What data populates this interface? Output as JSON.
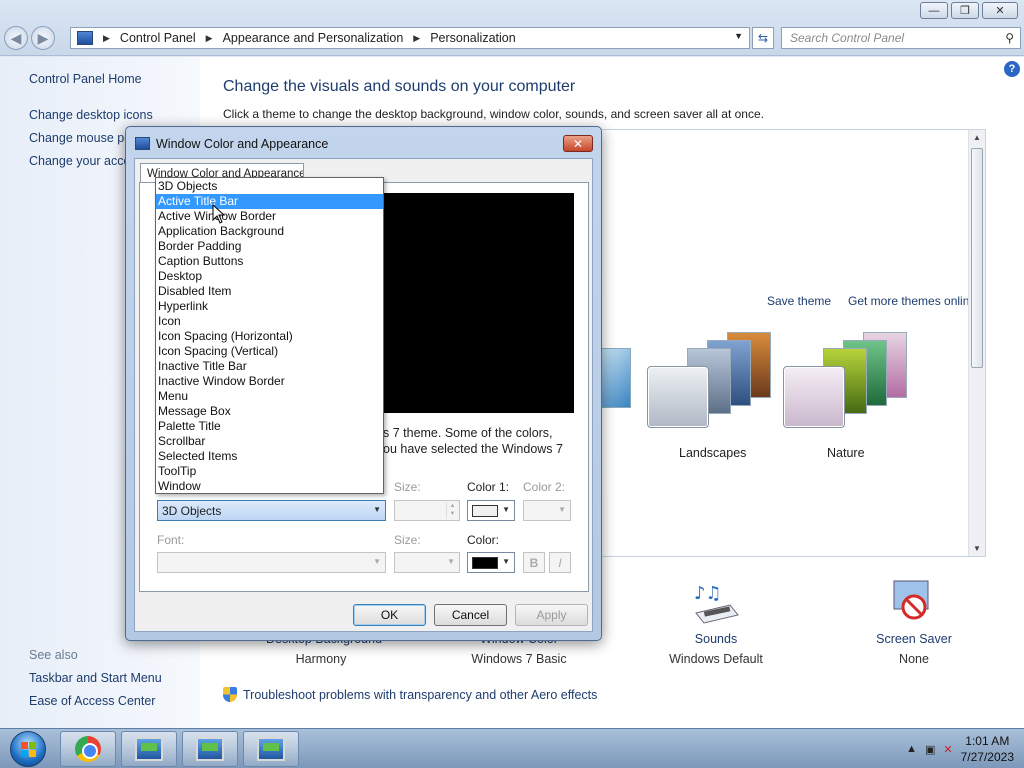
{
  "window": {
    "minimize_glyph": "—",
    "maximize_glyph": "❐",
    "close_glyph": "✕"
  },
  "address": {
    "crumbs": [
      "Control Panel",
      "Appearance and Personalization",
      "Personalization"
    ],
    "search_placeholder": "Search Control Panel"
  },
  "leftnav": {
    "home": "Control Panel Home",
    "links": [
      "Change desktop icons",
      "Change mouse po",
      "Change your acco"
    ],
    "see_also_title": "See also",
    "see_also": [
      "Taskbar and Start Menu",
      "Ease of Access Center"
    ]
  },
  "main": {
    "title": "Change the visuals and sounds on your computer",
    "subtitle": "Click a theme to change the desktop background, window color, sounds, and screen saver all at once.",
    "save_theme": "Save theme",
    "more_themes": "Get more themes online",
    "themes": [
      "Landscapes",
      "Nature"
    ],
    "bottom": [
      {
        "label": "Desktop Background",
        "value": "Harmony"
      },
      {
        "label": "Window Color",
        "value": "Windows 7 Basic"
      },
      {
        "label": "Sounds",
        "value": "Windows Default"
      },
      {
        "label": "Screen Saver",
        "value": "None"
      }
    ],
    "troubleshoot": "Troubleshoot problems with transparency and other Aero effects"
  },
  "dialog": {
    "title": "Window Color and Appearance",
    "tab": "Window Color and Appearance",
    "desc_line1": "s 7 theme.  Some of the colors,",
    "desc_line2": "ou have selected the Windows 7",
    "size_label": "Size:",
    "color1_label": "Color 1:",
    "color2_label": "Color 2:",
    "font_label": "Font:",
    "font_size_label": "Size:",
    "font_color_label": "Color:",
    "item_selected": "3D Objects",
    "bold": "B",
    "italic": "I",
    "ok": "OK",
    "cancel": "Cancel",
    "apply": "Apply",
    "items": [
      "3D Objects",
      "Active Title Bar",
      "Active Window Border",
      "Application Background",
      "Border Padding",
      "Caption Buttons",
      "Desktop",
      "Disabled Item",
      "Hyperlink",
      "Icon",
      "Icon Spacing (Horizontal)",
      "Icon Spacing (Vertical)",
      "Inactive Title Bar",
      "Inactive Window Border",
      "Menu",
      "Message Box",
      "Palette Title",
      "Scrollbar",
      "Selected Items",
      "ToolTip",
      "Window"
    ],
    "highlighted_index": 1
  },
  "taskbar": {
    "time": "1:01 AM",
    "date": "7/27/2023"
  },
  "colors": {
    "accent": "#3399ff",
    "active_title": "#0a0ad2",
    "link": "#1e3c6e"
  }
}
